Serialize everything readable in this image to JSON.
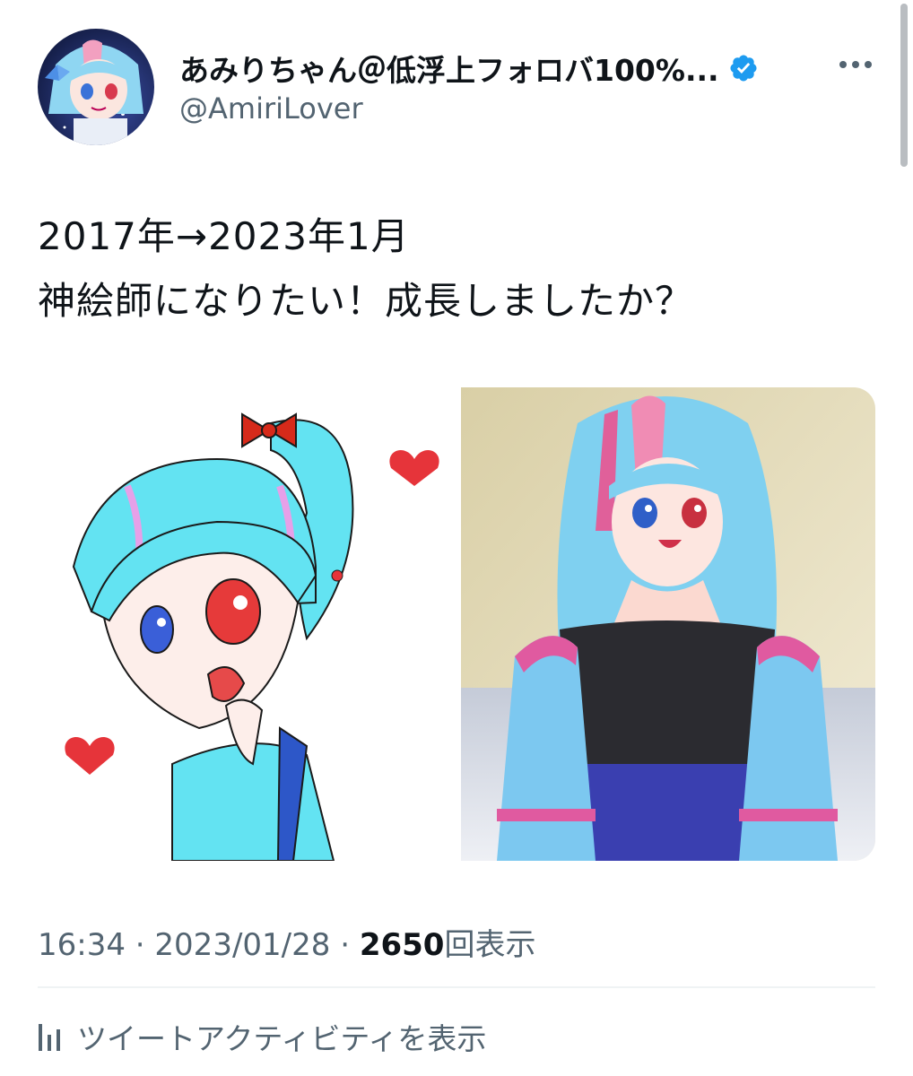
{
  "tweet": {
    "author": {
      "display_name": "あみりちゃん＠低浮上フォロバ100%...",
      "handle": "@AmiriLover",
      "verified": true,
      "verified_icon": "verified-badge-icon",
      "avatar": "avatar"
    },
    "more_icon": "more-horizontal-icon",
    "text_lines": [
      "2017年→2023年1月",
      "神絵師になりたい！成長しましたか？"
    ],
    "media": [
      {
        "name": "media-image-2017"
      },
      {
        "name": "media-image-2023"
      }
    ],
    "time": "16:34",
    "date": "2023/01/28",
    "separator": "·",
    "views_count": "2650",
    "views_label": "回表示",
    "activity_label": "ツイートアクティビティを表示",
    "activity_icon": "bar-chart-icon"
  },
  "colors": {
    "verified_blue": "#1d9bf0",
    "secondary_text": "#536471",
    "primary_text": "#0f1419"
  }
}
